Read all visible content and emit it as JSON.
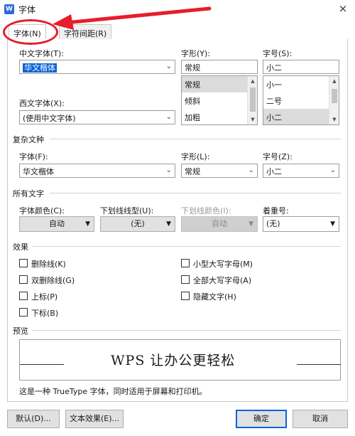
{
  "window": {
    "title": "字体",
    "close_glyph": "×",
    "app_icon_letter": "W"
  },
  "tabs": [
    {
      "label": "字体(N)",
      "active": true
    },
    {
      "label": "字符间距(R)",
      "active": false
    }
  ],
  "chinese_font": {
    "label": "中文字体(T):",
    "value": "华文楷体"
  },
  "western_font": {
    "label": "西文字体(X):",
    "value": "(使用中文字体)"
  },
  "font_style": {
    "label": "字形(Y):",
    "value": "常规",
    "options": [
      "常规",
      "倾斜",
      "加粗"
    ],
    "selected_index": 0
  },
  "font_size": {
    "label": "字号(S):",
    "value": "小二",
    "options": [
      "小一",
      "二号",
      "小二"
    ],
    "selected_index": 2
  },
  "complex": {
    "section": "复杂文种",
    "font_label": "字体(F):",
    "font_value": "华文楷体",
    "style_label": "字形(L):",
    "style_value": "常规",
    "size_label": "字号(Z):",
    "size_value": "小二"
  },
  "all_text": {
    "section": "所有文字",
    "color_label": "字体颜色(C):",
    "color_value": "自动",
    "underline_label": "下划线线型(U):",
    "underline_value": "(无)",
    "underline_color_label": "下划线颜色(I):",
    "underline_color_value": "自动",
    "emphasis_label": "着重号:",
    "emphasis_value": "(无)"
  },
  "effects": {
    "section": "效果",
    "left": [
      "删除线(K)",
      "双删除线(G)",
      "上标(P)",
      "下标(B)"
    ],
    "right": [
      "小型大写字母(M)",
      "全部大写字母(A)",
      "隐藏文字(H)"
    ]
  },
  "preview": {
    "section": "预览",
    "sample": "WPS 让办公更轻松",
    "note": "这是一种 TrueType 字体，同时适用于屏幕和打印机。"
  },
  "buttons": {
    "default": "默认(D)...",
    "text_effects": "文本效果(E)...",
    "ok": "确定",
    "cancel": "取消"
  },
  "colors": {
    "accent": "#0a64d6",
    "annotation": "#e81c2b"
  }
}
